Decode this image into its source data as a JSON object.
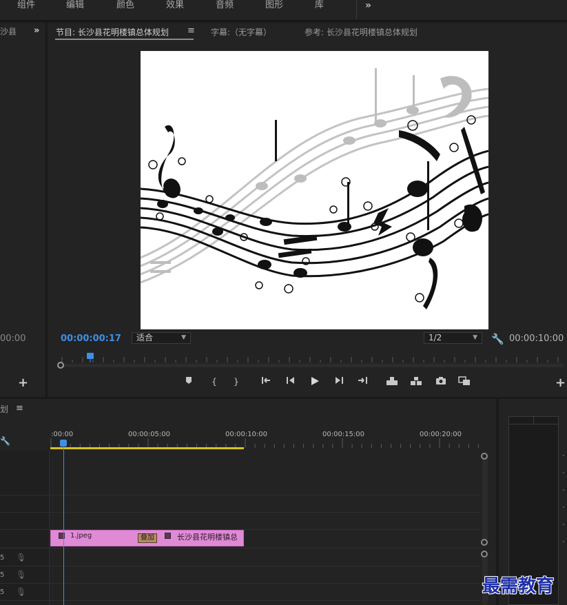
{
  "workspaces": {
    "items": [
      "组件",
      "编辑",
      "颜色",
      "效果",
      "音频",
      "图形",
      "库"
    ],
    "more": "»"
  },
  "left_panel": {
    "tab": "沙县",
    "more": "»",
    "timecode": "00:00",
    "add": "+"
  },
  "program_monitor": {
    "tabs": {
      "program": "节目: 长沙县花明楼镇总体规划",
      "menu": "≡",
      "captions": "字幕:（无字幕）",
      "reference": "参考: 长沙县花明楼镇总体规划"
    },
    "current_timecode": "00:00:00:17",
    "fit_option": "适合",
    "resolution_option": "1/2",
    "duration_timecode": "00:00:10:00",
    "add": "+"
  },
  "timeline": {
    "title": "划",
    "menu": "≡",
    "ruler_labels": [
      ":00:00",
      "00:00:05:00",
      "00:00:10:00",
      "00:00:15:00",
      "00:00:20:00"
    ],
    "audio_tracks": [
      "5",
      "5",
      "5"
    ],
    "clip": {
      "name": "1.jpeg",
      "transition": "叠加",
      "next_name": "长沙县花明楼镇总"
    }
  },
  "watermark": "最需教育",
  "colors": {
    "accent_blue": "#3d8fe6",
    "clip_pink": "#e08ad6",
    "work_area_yellow": "#d6c21a",
    "panel_bg": "#232323"
  }
}
